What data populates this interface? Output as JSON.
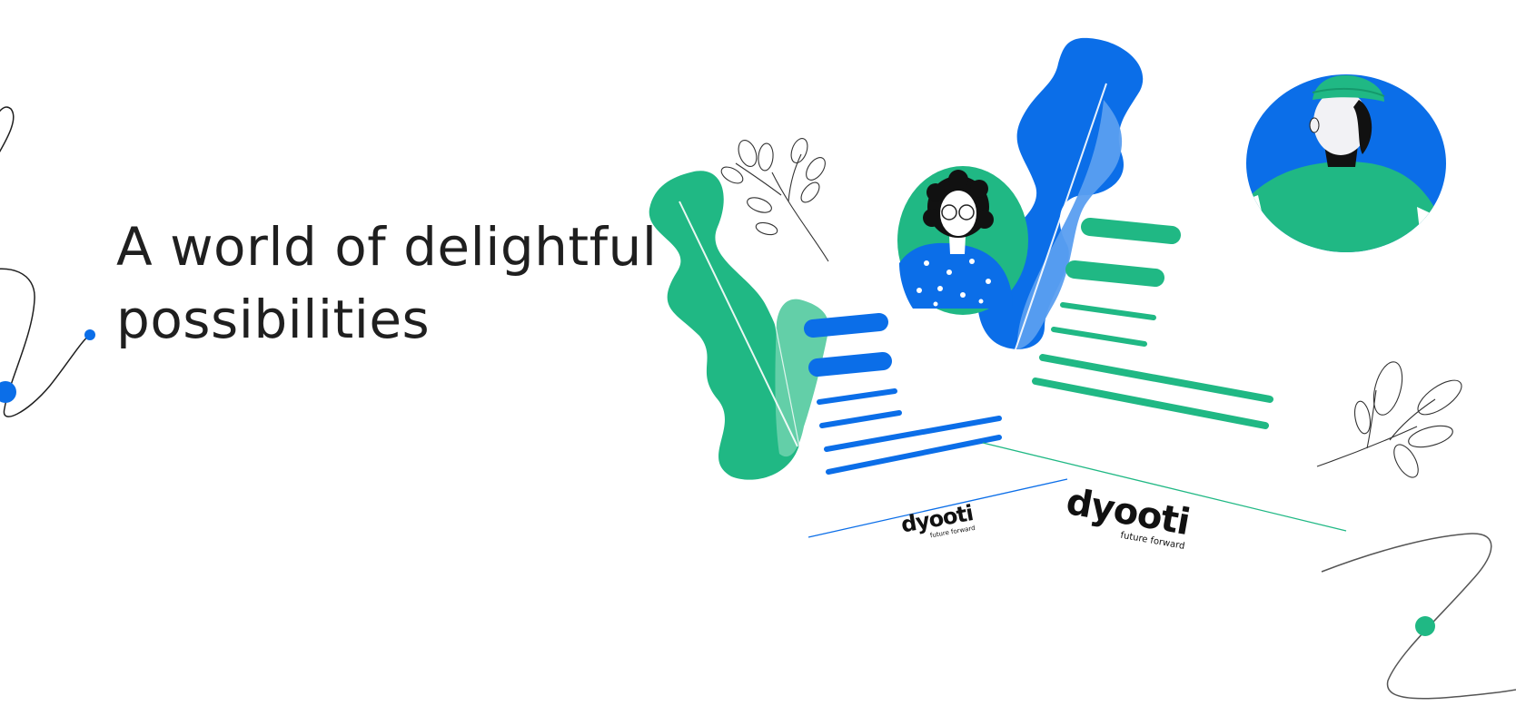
{
  "headline": {
    "line1": "A world of delightful",
    "line2": "possibilities"
  },
  "brand_left": {
    "name": "dyooti",
    "tagline": "future forward"
  },
  "brand_right": {
    "name": "dyooti",
    "tagline": "future forward"
  },
  "colors": {
    "green": "#20b884",
    "green_light": "#63cfa8",
    "blue": "#0b6ee8",
    "blue_light": "#5a9ef0",
    "ink": "#1f1f1f"
  },
  "icons": [
    "green-leaf-shape",
    "blue-leaf-shape",
    "person-curly-hair-avatar",
    "person-green-cap-avatar",
    "sketch-leaf-branch",
    "swirl-line",
    "blue-dot",
    "green-dot"
  ]
}
